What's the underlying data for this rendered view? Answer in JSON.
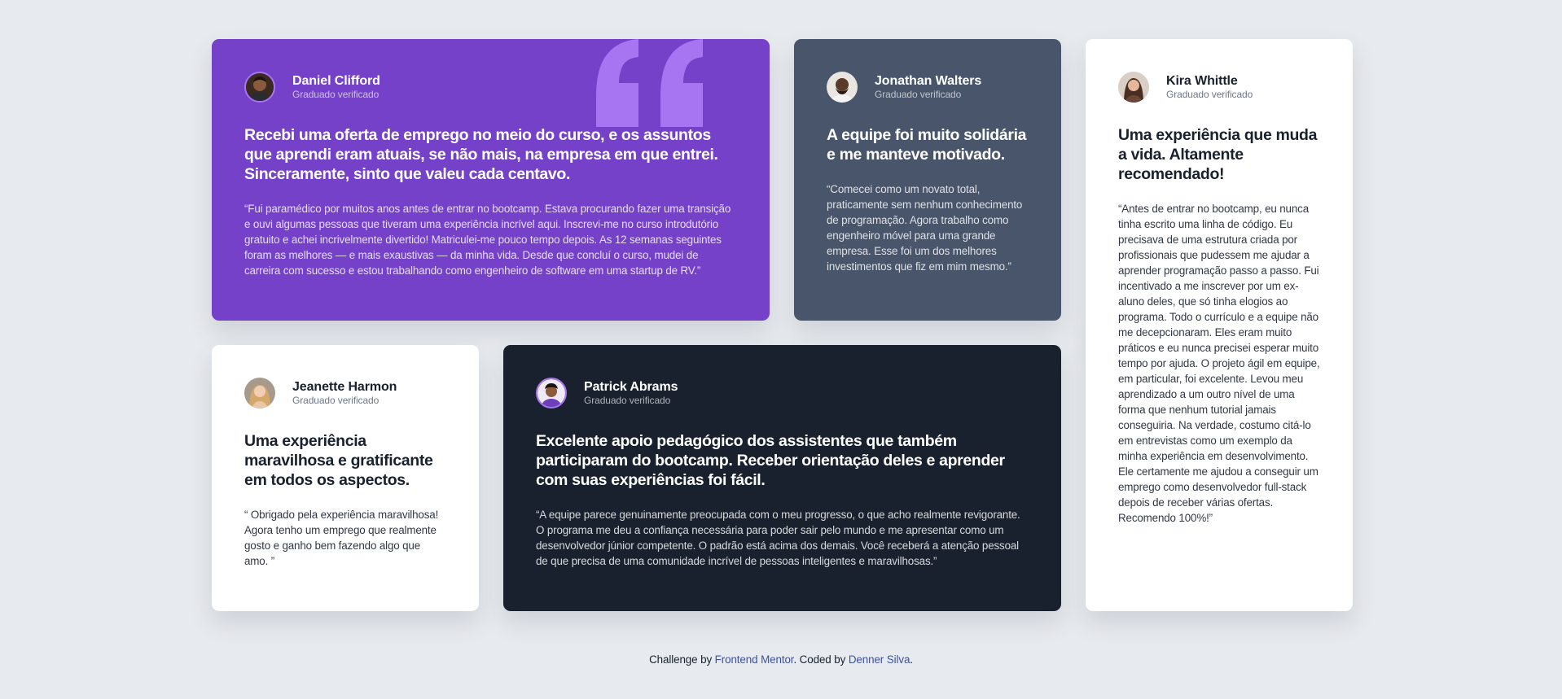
{
  "colors": {
    "purple": "#7541c8",
    "slate": "#48556a",
    "white": "#ffffff",
    "dark": "#19212e",
    "background": "#e7eaee",
    "link": "#3e52a3"
  },
  "testimonials": [
    {
      "name": "Daniel Clifford",
      "role": "Graduado verificado",
      "headline": "Recebi uma oferta de emprego no meio do curso, e os assuntos que aprendi eram atuais, se não mais, na empresa em que entrei. Sinceramente, sinto que valeu cada centavo.",
      "body": "“Fui paramédico por muitos anos antes de entrar no bootcamp. Estava procurando fazer uma transição e ouvi algumas pessoas que tiveram uma experiência incrível aqui. Inscrevi-me no curso introdutório gratuito e achei incrivelmente divertido! Matriculei-me pouco tempo depois. As 12 semanas seguintes foram as melhores — e mais exaustivas — da minha vida. Desde que concluí o curso, mudei de carreira com sucesso e estou trabalhando como engenheiro de software em uma startup de RV.”",
      "icon": "quotation-mark-icon"
    },
    {
      "name": "Jonathan Walters",
      "role": "Graduado verificado",
      "headline": "A equipe foi muito solidária e me manteve motivado.",
      "body": "“Comecei como um novato total, praticamente sem nenhum conhecimento de programação. Agora trabalho como engenheiro móvel para uma grande empresa. Esse foi um dos melhores investimentos que fiz em mim mesmo.”"
    },
    {
      "name": "Kira Whittle",
      "role": "Graduado verificado",
      "headline": "Uma experiência que muda a vida. Altamente recomendado!",
      "body": "“Antes de entrar no bootcamp, eu nunca tinha escrito uma linha de código. Eu precisava de uma estrutura criada por profissionais que pudessem me ajudar a aprender programação passo a passo. Fui incentivado a me inscrever por um ex-aluno deles, que só tinha elogios ao programa. Todo o currículo e a equipe não me decepcionaram. Eles eram muito práticos e eu nunca precisei esperar muito tempo por ajuda. O projeto ágil em equipe, em particular, foi excelente. Levou meu aprendizado a um outro nível de uma forma que nenhum tutorial jamais conseguiria. Na verdade, costumo citá-lo em entrevistas como um exemplo da minha experiência em desenvolvimento. Ele certamente me ajudou a conseguir um emprego como desenvolvedor full-stack depois de receber várias ofertas. Recomendo 100%!”"
    },
    {
      "name": "Jeanette Harmon",
      "role": "Graduado verificado",
      "headline": "Uma experiência maravilhosa e gratificante em todos os aspectos.",
      "body": "“ Obrigado pela experiência maravilhosa! Agora tenho um emprego que realmente gosto e ganho bem fazendo algo que amo. ”"
    },
    {
      "name": "Patrick Abrams",
      "role": "Graduado verificado",
      "headline": "Excelente apoio pedagógico dos assistentes que também participaram do bootcamp. Receber orientação deles e aprender com suas experiências foi fácil.",
      "body": "“A equipe parece genuinamente preocupada com o meu progresso, o que acho realmente revigorante. O programa me deu a confiança necessária para poder sair pelo mundo e me apresentar como um desenvolvedor júnior competente. O padrão está acima dos demais. Você receberá a atenção pessoal de que precisa de uma comunidade incrível de pessoas inteligentes e maravilhosas.”"
    }
  ],
  "footer": {
    "prefix": "Challenge by ",
    "link1": "Frontend Mentor",
    "middle": ". Coded by ",
    "link2": "Denner Silva",
    "suffix": "."
  }
}
